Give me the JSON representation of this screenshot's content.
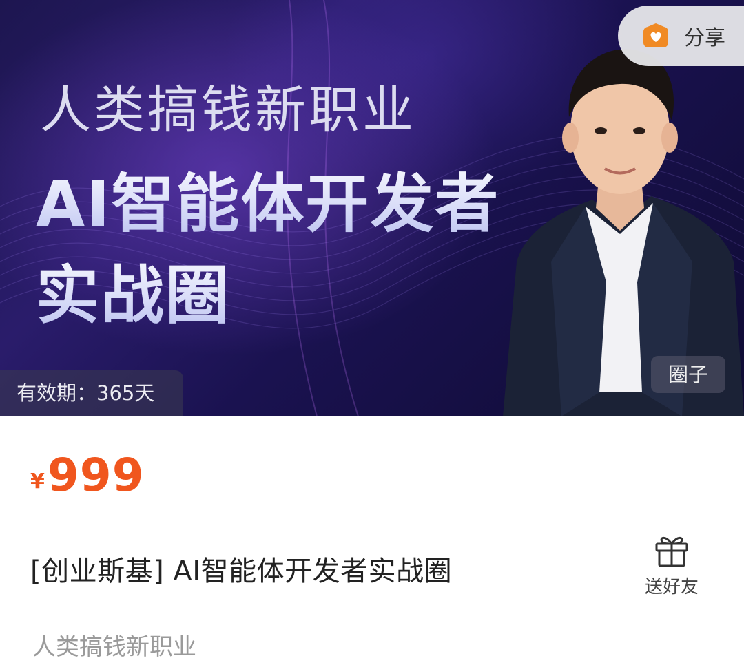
{
  "banner": {
    "headline_small": "人类搞钱新职业",
    "headline_line1": "AI智能体开发者",
    "headline_line2": "实战圈",
    "validity": "有效期：365天",
    "type_tag": "圈子",
    "share_label": "分享"
  },
  "product": {
    "currency_symbol": "¥",
    "price": "999",
    "title": "[创业斯基] AI智能体开发者实战圈",
    "subtitle": "人类搞钱新职业",
    "gift_label": "送好友"
  },
  "colors": {
    "price": "#f0561e",
    "share_icon": "#f08a24",
    "banner_bg": "#1d1650"
  },
  "icons": {
    "share": "share-icon",
    "gift": "gift-icon"
  }
}
